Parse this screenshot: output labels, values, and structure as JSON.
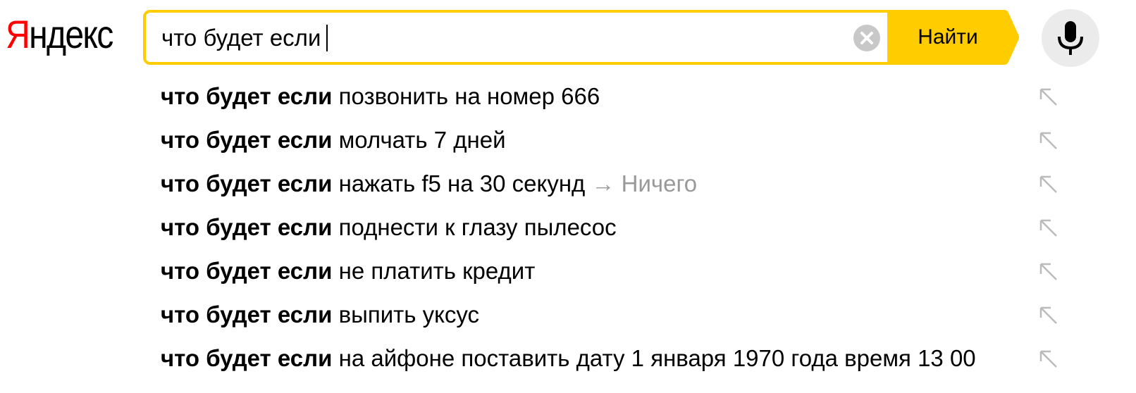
{
  "logo": {
    "first_letter": "Я",
    "rest": "ндекс"
  },
  "search": {
    "value": "что будет если",
    "clear_icon": "clear-icon",
    "button_label": "Найти"
  },
  "mic": {
    "icon": "microphone-icon"
  },
  "colors": {
    "accent": "#ffcc00",
    "logo_red": "#ff0000",
    "hint_gray": "#999999",
    "mic_bg": "#ebebeb"
  },
  "suggestions": [
    {
      "bold": "что будет если",
      "rest": "позвонить на номер 666",
      "arrow": "",
      "answer": ""
    },
    {
      "bold": "что будет если",
      "rest": "молчать 7 дней",
      "arrow": "",
      "answer": ""
    },
    {
      "bold": "что будет если",
      "rest": "нажать f5 на 30 секунд",
      "arrow": "→",
      "answer": "Ничего"
    },
    {
      "bold": "что будет если",
      "rest": "поднести к глазу пылесос",
      "arrow": "",
      "answer": ""
    },
    {
      "bold": "что будет если",
      "rest": "не платить кредит",
      "arrow": "",
      "answer": ""
    },
    {
      "bold": "что будет если",
      "rest": "выпить уксус",
      "arrow": "",
      "answer": ""
    },
    {
      "bold": "что будет если",
      "rest": "на айфоне поставить дату 1 января 1970 года время 13 00",
      "arrow": "",
      "answer": ""
    }
  ]
}
